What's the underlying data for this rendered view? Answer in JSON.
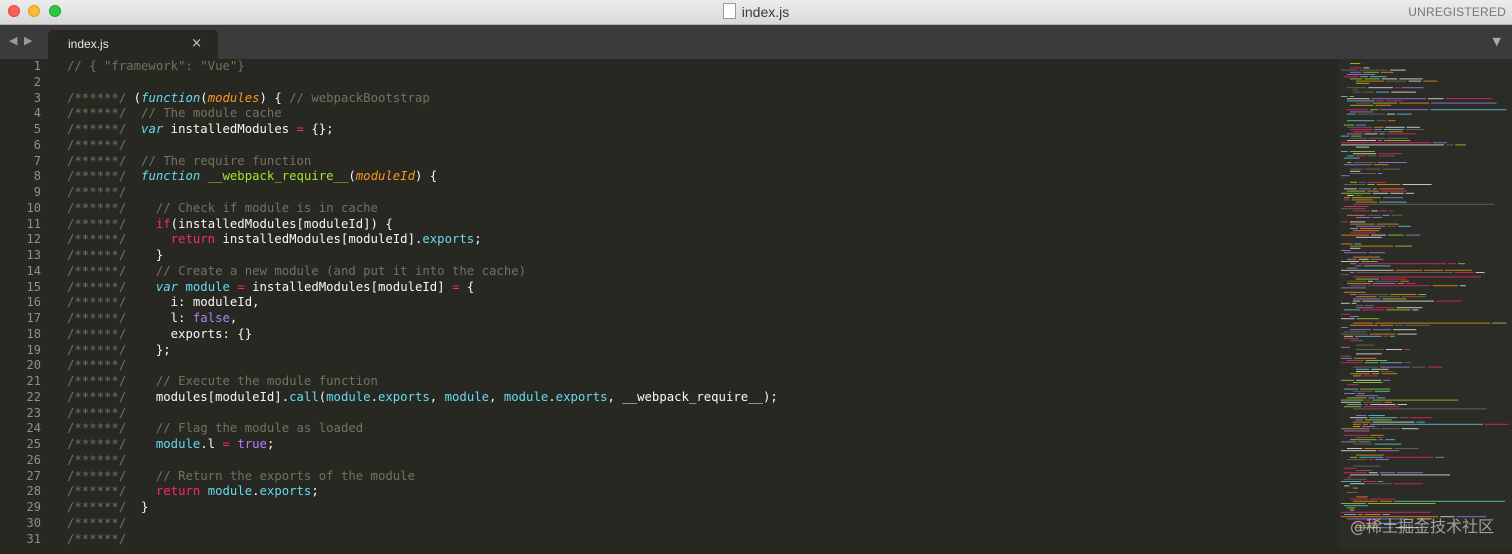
{
  "window": {
    "title": "index.js",
    "license_status": "UNREGISTERED"
  },
  "tabs": [
    {
      "label": "index.js",
      "close": "×"
    }
  ],
  "navigation": {
    "back": "◀",
    "forward": "▶",
    "menu": "▼"
  },
  "editor": {
    "language": "javascript",
    "line_numbers": [
      "1",
      "2",
      "3",
      "4",
      "5",
      "6",
      "7",
      "8",
      "9",
      "10",
      "11",
      "12",
      "13",
      "14",
      "15",
      "16",
      "17",
      "18",
      "19",
      "20",
      "21",
      "22",
      "23",
      "24",
      "25",
      "26",
      "27",
      "28",
      "29",
      "30",
      "31"
    ],
    "lines": [
      "// { \"framework\": \"Vue\"}",
      "",
      "/******/ (function(modules) { // webpackBootstrap",
      "/******/  // The module cache",
      "/******/  var installedModules = {};",
      "/******/",
      "/******/  // The require function",
      "/******/  function __webpack_require__(moduleId) {",
      "/******/",
      "/******/    // Check if module is in cache",
      "/******/    if(installedModules[moduleId]) {",
      "/******/      return installedModules[moduleId].exports;",
      "/******/    }",
      "/******/    // Create a new module (and put it into the cache)",
      "/******/    var module = installedModules[moduleId] = {",
      "/******/      i: moduleId,",
      "/******/      l: false,",
      "/******/      exports: {}",
      "/******/    };",
      "/******/",
      "/******/    // Execute the module function",
      "/******/    modules[moduleId].call(module.exports, module, module.exports, __webpack_require__);",
      "/******/",
      "/******/    // Flag the module as loaded",
      "/******/    module.l = true;",
      "/******/",
      "/******/    // Return the exports of the module",
      "/******/    return module.exports;",
      "/******/  }",
      "/******/",
      "/******/"
    ]
  },
  "watermark": "@稀土掘金技术社区",
  "colors": {
    "background": "#272822",
    "comment": "#75715e",
    "keyword": "#f92672",
    "storage": "#66d9ef",
    "constant": "#ae81ff",
    "function": "#a6e22e",
    "parameter": "#fd971f"
  }
}
